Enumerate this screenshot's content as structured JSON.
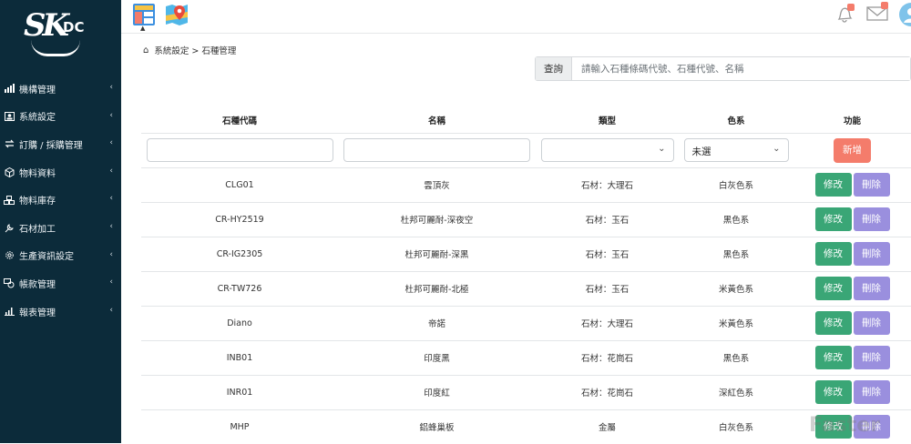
{
  "brand": {
    "logo_text": "SK",
    "logo_suffix": "DC"
  },
  "sidebar": {
    "items": [
      {
        "label": "機構管理",
        "icon": "bar-chart-icon"
      },
      {
        "label": "系統設定",
        "icon": "user-card-icon"
      },
      {
        "label": "訂購 / 採購管理",
        "icon": "exchange-icon"
      },
      {
        "label": "物料資料",
        "icon": "cube-icon"
      },
      {
        "label": "物料庫存",
        "icon": "boxes-icon"
      },
      {
        "label": "石材加工",
        "icon": "tool-icon"
      },
      {
        "label": "生產資訊設定",
        "icon": "gear-icon"
      },
      {
        "label": "帳款管理",
        "icon": "money-icon"
      },
      {
        "label": "報表管理",
        "icon": "report-chart-icon"
      }
    ]
  },
  "breadcrumb": {
    "path": "系統設定 > 石種管理"
  },
  "search": {
    "button": "查詢",
    "placeholder": "請輸入石種條碼代號、石種代號、名稱"
  },
  "table": {
    "headers": [
      "石種代碼",
      "名稱",
      "類型",
      "色系",
      "功能"
    ],
    "filter": {
      "color_select": "未選",
      "add_label": "新增"
    },
    "edit_label": "修改",
    "delete_label": "刪除",
    "rows": [
      {
        "code": "CLG01",
        "name": "雲頂灰",
        "type": "石材：大理石",
        "color": "白灰色系"
      },
      {
        "code": "CR-HY2519",
        "name": "杜邦可麗耐-深夜空",
        "type": "石材：玉石",
        "color": "黑色系"
      },
      {
        "code": "CR-IG2305",
        "name": "杜邦可麗耐-深黑",
        "type": "石材：玉石",
        "color": "黑色系"
      },
      {
        "code": "CR-TW726",
        "name": "杜邦可麗耐-北極",
        "type": "石材：玉石",
        "color": "米黃色系"
      },
      {
        "code": "Diano",
        "name": "帝諾",
        "type": "石材：大理石",
        "color": "米黃色系"
      },
      {
        "code": "INB01",
        "name": "印度黑",
        "type": "石材：花崗石",
        "color": "黑色系"
      },
      {
        "code": "INR01",
        "name": "印度紅",
        "type": "石材：花崗石",
        "color": "深紅色系"
      },
      {
        "code": "MHP",
        "name": "鋁蜂巢板",
        "type": "金屬",
        "color": "白灰色系"
      }
    ]
  },
  "watermark": "Faster",
  "colors": {
    "sidebar": "#0c2b3a",
    "edit": "#3aa676",
    "delete": "#9a8fde",
    "add": "#f47c6b"
  }
}
